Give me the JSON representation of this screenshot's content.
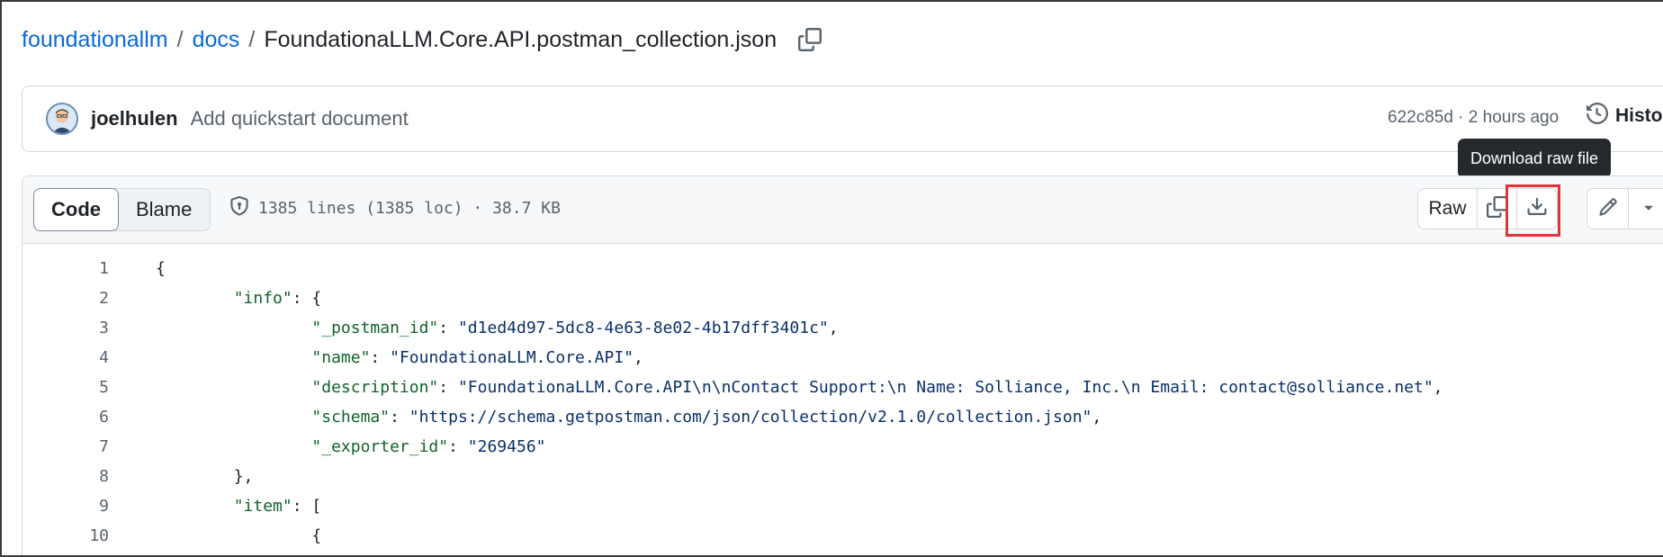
{
  "breadcrumb": {
    "owner": "foundationallm",
    "folder": "docs",
    "file": "FoundationaLLM.Core.API.postman_collection.json",
    "separator": "/"
  },
  "commit": {
    "author": "joelhulen",
    "message": "Add quickstart document",
    "meta": "622c85d · 2 hours ago",
    "history_label": "History"
  },
  "file_header": {
    "tab_code": "Code",
    "tab_blame": "Blame",
    "info": "1385 lines (1385 loc) · 38.7 KB",
    "raw_label": "Raw",
    "tooltip": "Download raw file"
  },
  "code_lines": [
    {
      "n": "1",
      "text": "{"
    },
    {
      "n": "2",
      "text": "        \"info\": {"
    },
    {
      "n": "3",
      "text": "                \"_postman_id\": \"d1ed4d97-5dc8-4e63-8e02-4b17dff3401c\","
    },
    {
      "n": "4",
      "text": "                \"name\": \"FoundationaLLM.Core.API\","
    },
    {
      "n": "5",
      "text": "                \"description\": \"FoundationaLLM.Core.API\\n\\nContact Support:\\n Name: Solliance, Inc.\\n Email: contact@solliance.net\","
    },
    {
      "n": "6",
      "text": "                \"schema\": \"https://schema.getpostman.com/json/collection/v2.1.0/collection.json\","
    },
    {
      "n": "7",
      "text": "                \"_exporter_id\": \"269456\""
    },
    {
      "n": "8",
      "text": "        },"
    },
    {
      "n": "9",
      "text": "        \"item\": ["
    },
    {
      "n": "10",
      "text": "                {"
    }
  ],
  "colors": {
    "link": "#0969da",
    "key": "#116329",
    "string": "#0a3069",
    "highlight": "#e3343a"
  }
}
